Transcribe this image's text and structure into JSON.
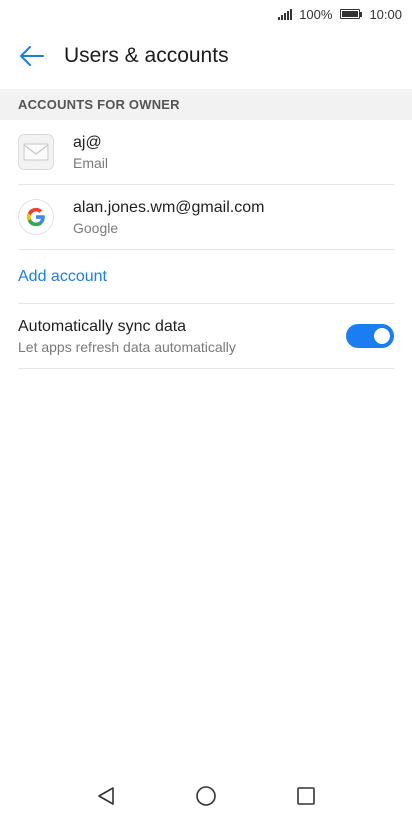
{
  "status_bar": {
    "battery": "100%",
    "time": "10:00"
  },
  "header": {
    "title": "Users & accounts"
  },
  "section": {
    "header": "ACCOUNTS FOR OWNER"
  },
  "accounts": [
    {
      "name": "aj@",
      "type": "Email",
      "icon": "email-icon"
    },
    {
      "name": "alan.jones.wm@gmail.com",
      "type": "Google",
      "icon": "google-icon"
    }
  ],
  "add_account": {
    "label": "Add account"
  },
  "sync": {
    "title": "Automatically sync data",
    "subtitle": "Let apps refresh data automatically",
    "enabled": true
  },
  "colors": {
    "accent": "#1e7ee0",
    "toggle_on": "#1a7ef2",
    "section_bg": "#f2f2f2"
  },
  "nav": {
    "back": "back-triangle-icon",
    "home": "home-circle-icon",
    "recents": "recents-square-icon"
  }
}
